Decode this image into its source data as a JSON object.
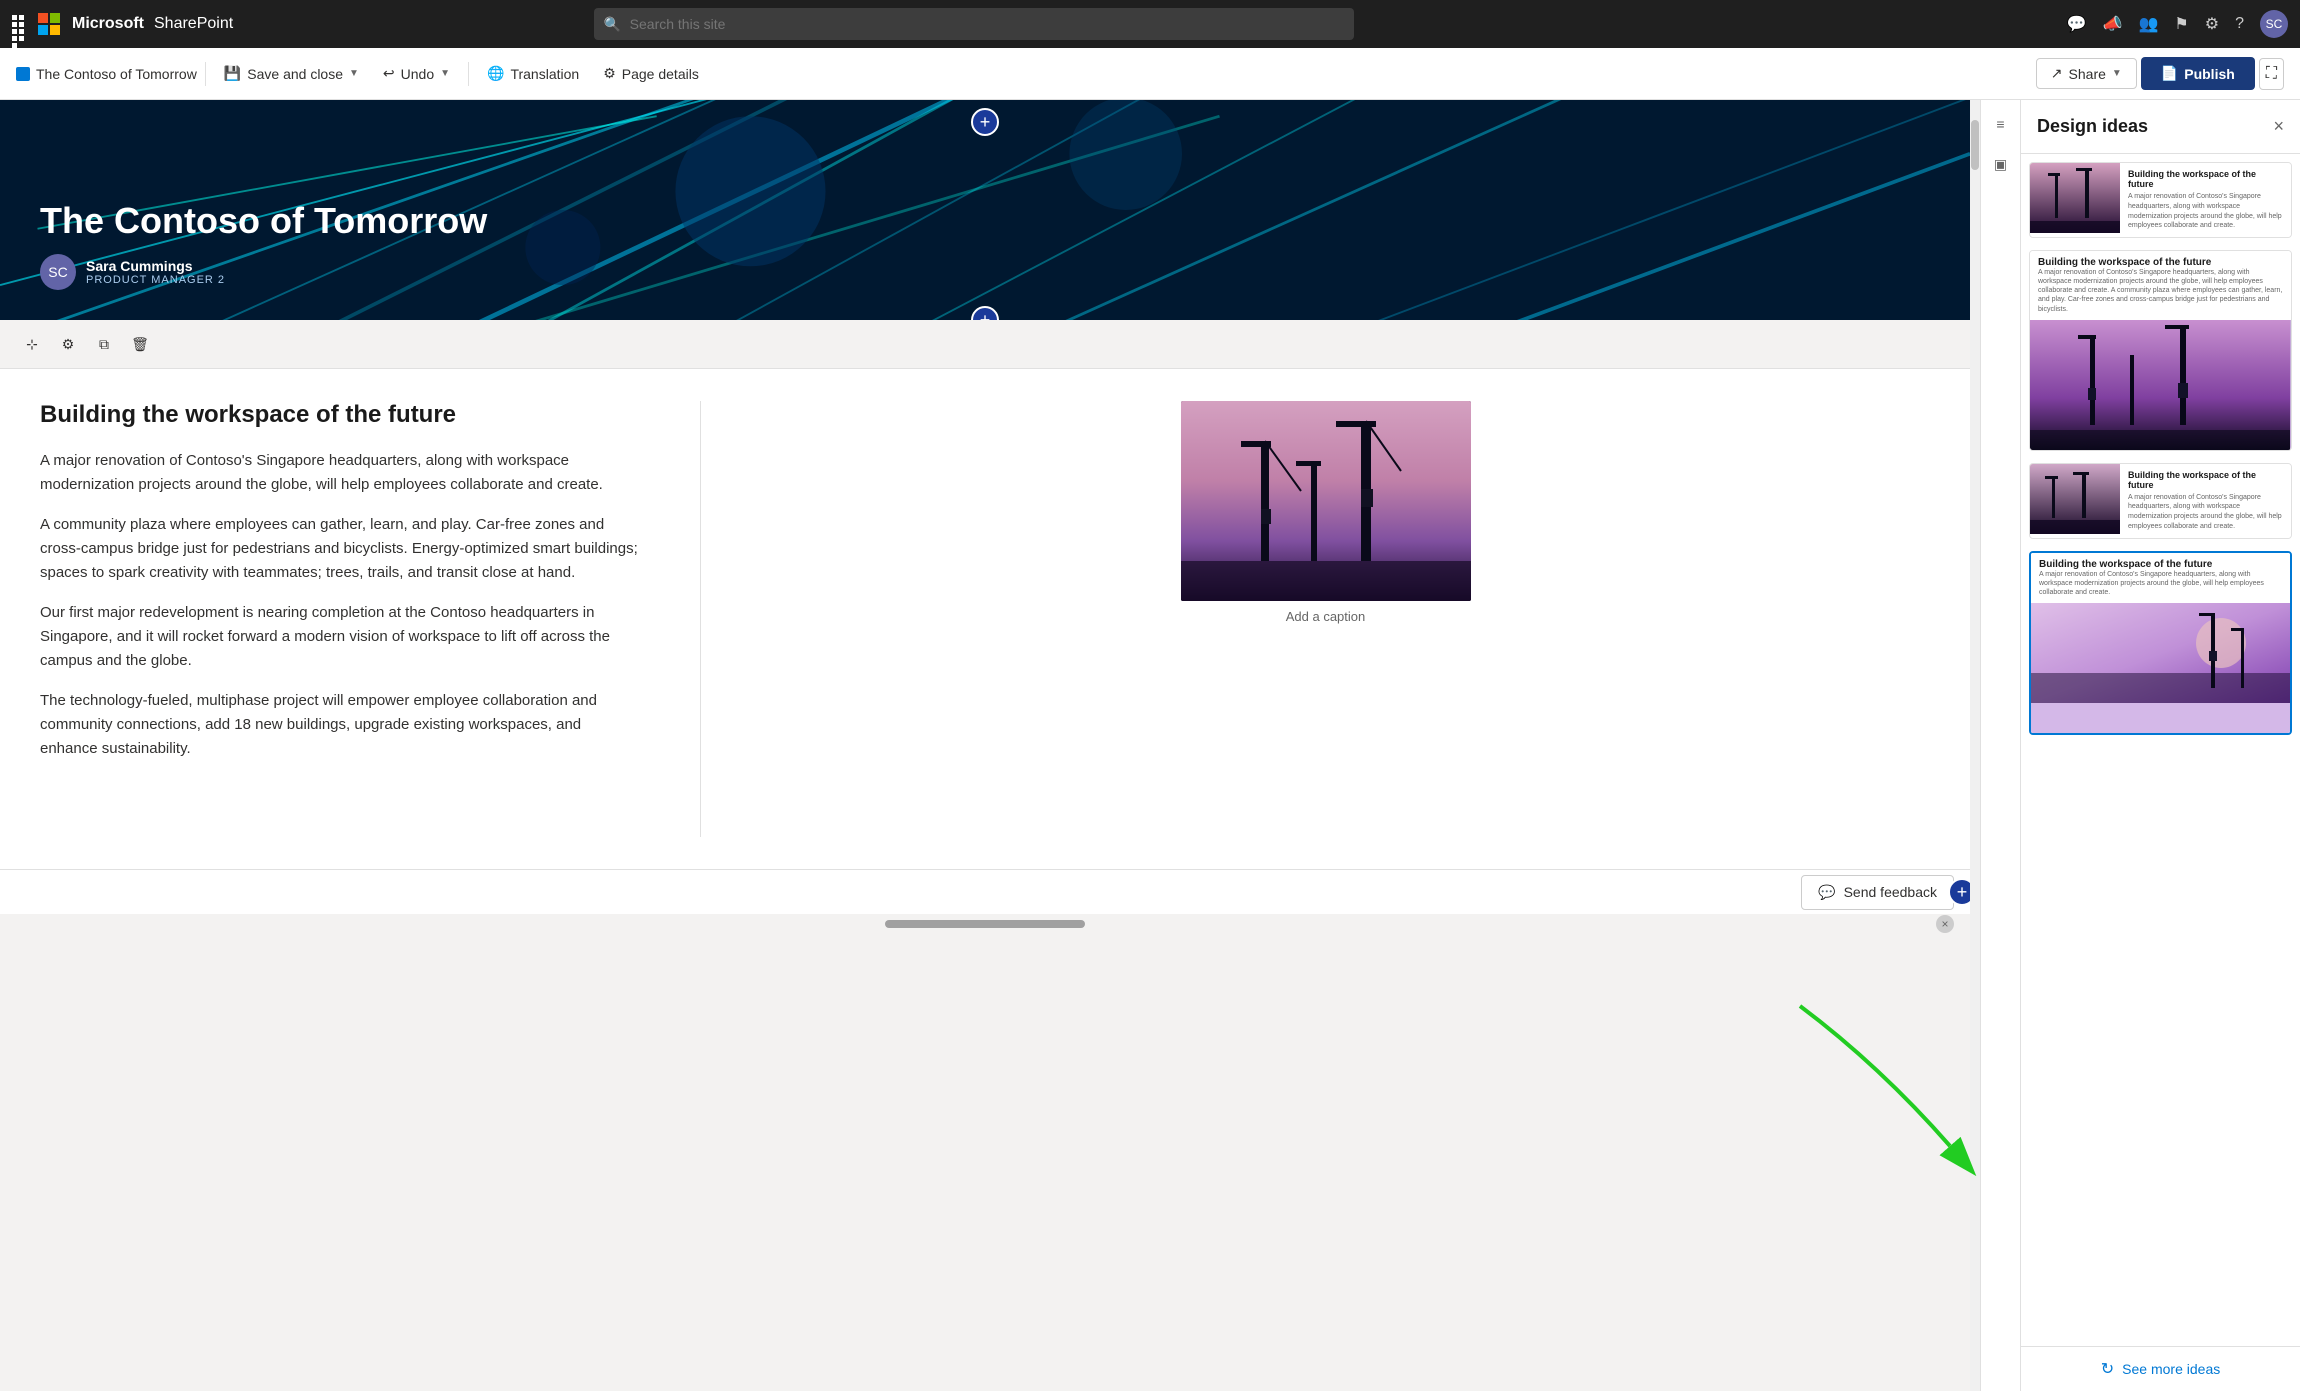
{
  "app": {
    "name": "SharePoint",
    "ms_label": "Microsoft"
  },
  "nav": {
    "search_placeholder": "Search this site",
    "icons": [
      "grid",
      "feedback",
      "people",
      "flag",
      "settings",
      "help",
      "avatar"
    ]
  },
  "toolbar": {
    "page_name": "The Contoso of Tomorrow",
    "save_close": "Save and close",
    "undo": "Undo",
    "translation": "Translation",
    "page_details": "Page details",
    "share": "Share",
    "publish": "Publish"
  },
  "hero": {
    "title": "The Contoso of Tomorrow",
    "author_name": "Sara Cummings",
    "author_role": "PRODUCT MANAGER 2",
    "author_initials": "SC"
  },
  "content": {
    "heading": "Building the workspace of the future",
    "paragraph1": "A major renovation of Contoso's Singapore headquarters, along with workspace modernization projects around the globe, will help employees collaborate and create.",
    "paragraph2": "A community plaza where employees can gather, learn, and play. Car-free zones and cross-campus bridge just for pedestrians and bicyclists. Energy-optimized smart buildings; spaces to spark creativity with teammates; trees, trails, and transit close at hand.",
    "paragraph3": "Our first major redevelopment is nearing completion at the Contoso headquarters in Singapore, and it will rocket forward a modern vision of workspace to lift off across the campus and the globe.",
    "paragraph4": "The technology-fueled, multiphase project will empower employee collaboration and community connections, add 18 new buildings, upgrade existing workspaces, and enhance sustainability.",
    "image_caption": "Add a caption"
  },
  "design_panel": {
    "title": "Design ideas",
    "close_label": "×",
    "card1_title": "Building the workspace of the future",
    "card1_body": "A major renovation of Contoso's Singapore headquarters, along with workspace modernization projects around the globe, will help employees collaborate and create.",
    "card2_title": "Building the workspace of the future",
    "card2_body": "A major renovation of Contoso's Singapore headquarters, along with workspace modernization projects around the globe, will help employees collaborate and create. A community plaza where employees can gather, learn, and play. Car-free zones and cross-campus bridge just for pedestrians and bicyclists.",
    "card3_title": "Building the workspace of the future",
    "card3_body": "A major renovation of Contoso's Singapore headquarters, along with workspace modernization projects around the globe, will help employees collaborate and create.",
    "card4_title": "Building the workspace of the future",
    "card4_body": "A major renovation of Contoso's Singapore headquarters, along with workspace modernization projects around the globe, will help employees collaborate and create.",
    "see_more": "See more ideas",
    "send_feedback": "Send feedback",
    "refresh_icon": "↻"
  },
  "colors": {
    "publish_bg": "#1a3a7a",
    "accent": "#0078d4",
    "hero_bg": "#002244"
  }
}
